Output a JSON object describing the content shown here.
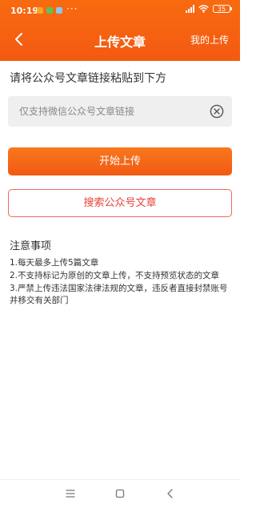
{
  "status_bar": {
    "time": "10:19",
    "more": "···",
    "battery": "35",
    "app_icon_colors": [
      "#f5a623",
      "#5cc35a",
      "#8ac6f0"
    ]
  },
  "nav": {
    "title": "上传文章",
    "right_link": "我的上传",
    "back_icon": "chevron-left-icon"
  },
  "form": {
    "prompt": "请将公众号文章链接粘贴到下方",
    "input_placeholder": "仅支持微信公众号文章链接",
    "input_value": "",
    "clear_icon": "close-circle-icon"
  },
  "buttons": {
    "upload": "开始上传",
    "search": "搜索公众号文章"
  },
  "notes": {
    "title": "注意事项",
    "items": [
      "1.每天最多上传5篇文章",
      "2.不支持标记为原创的文章上传，不支持预览状态的文章",
      "3.严禁上传违法国家法律法规的文章，违反者直接封禁账号并移交有关部门"
    ]
  },
  "colors": {
    "header_top": "#f86a10",
    "header_bottom": "#f35a12",
    "search_border": "#f06a5a",
    "search_text": "#e8433a"
  }
}
